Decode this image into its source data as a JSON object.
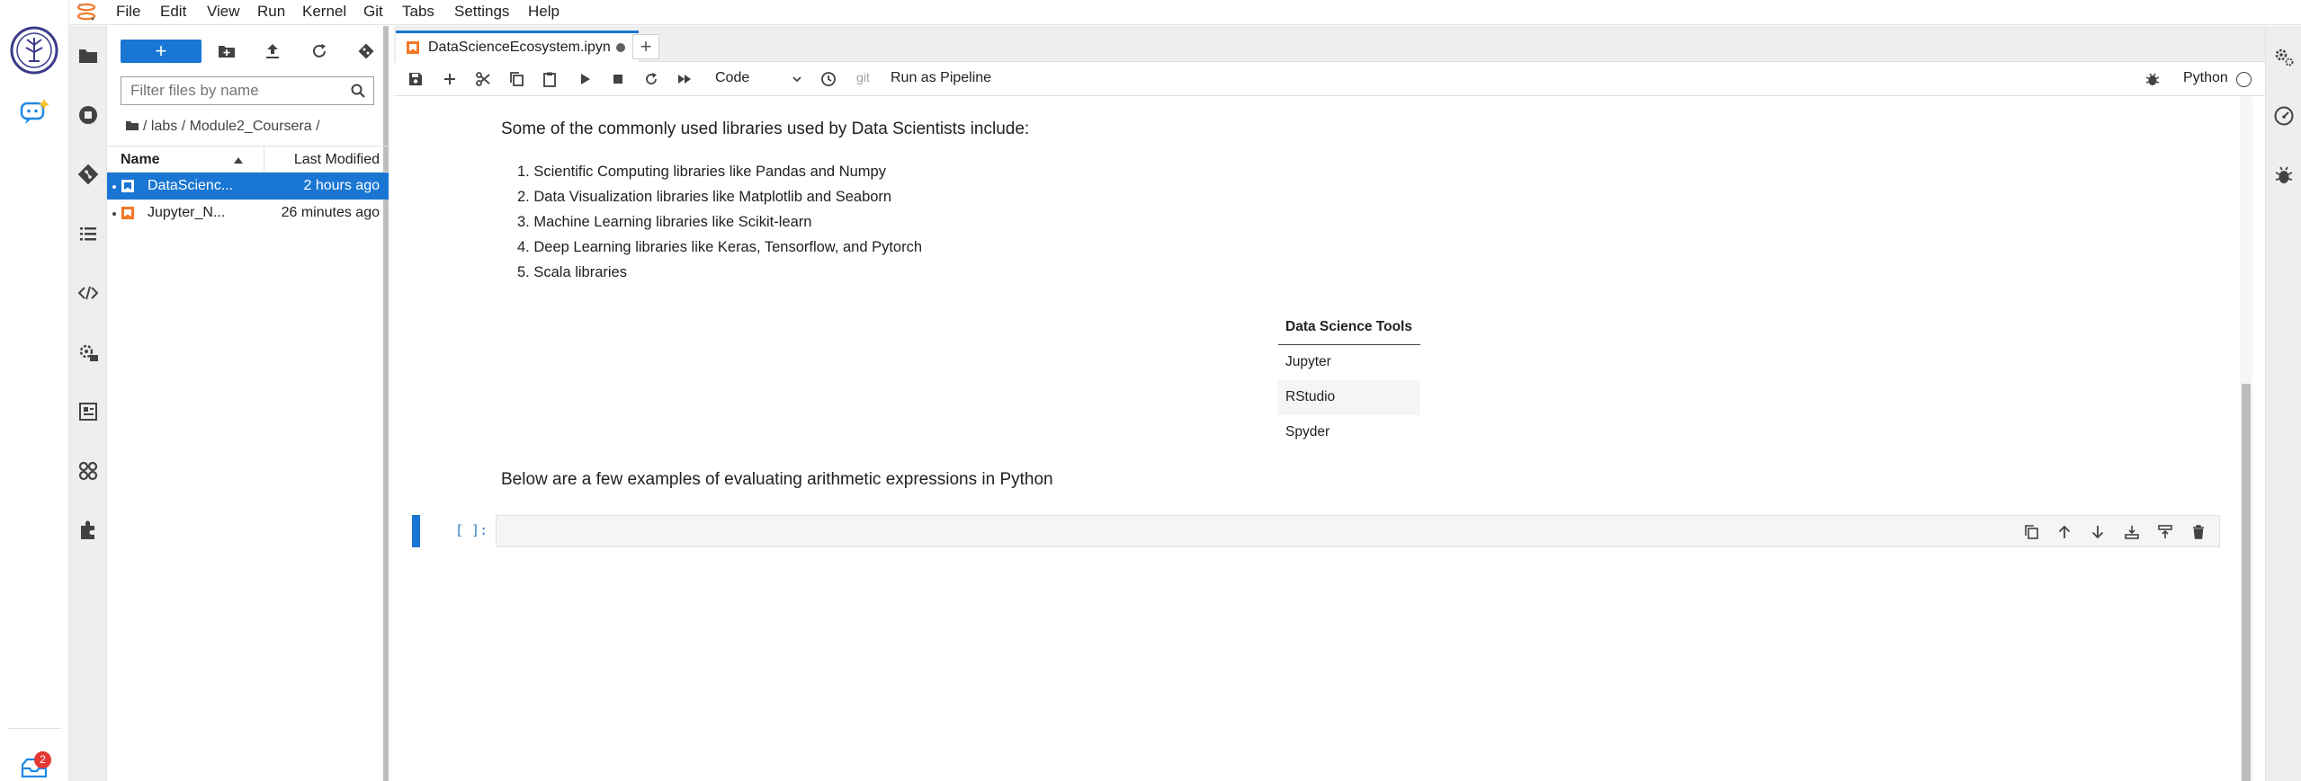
{
  "menu": [
    "File",
    "Edit",
    "View",
    "Run",
    "Kernel",
    "Git",
    "Tabs",
    "Settings",
    "Help"
  ],
  "notification_count": "2",
  "file_browser": {
    "filter_placeholder": "Filter files by name",
    "breadcrumb": "/ labs / Module2_Coursera /",
    "col_name": "Name",
    "col_modified": "Last Modified",
    "files": [
      {
        "name": "DataScienc...",
        "modified": "2 hours ago"
      },
      {
        "name": "Jupyter_N...",
        "modified": "26 minutes ago"
      }
    ]
  },
  "tab": {
    "title": "DataScienceEcosystem.ipyn"
  },
  "toolbar": {
    "cell_type": "Code",
    "git_label": "git",
    "pipeline_label": "Run as Pipeline",
    "kernel_name": "Python"
  },
  "notebook": {
    "intro": "Some of the commonly used libraries used by Data Scientists include:",
    "libraries": [
      "Scientific Computing libraries like Pandas and Numpy",
      "Data Visualization libraries like Matplotlib and Seaborn",
      "Machine Learning libraries like Scikit-learn",
      "Deep Learning libraries like Keras, Tensorflow, and Pytorch",
      "Scala libraries"
    ],
    "table": {
      "header": "Data Science Tools",
      "rows": [
        "Jupyter",
        "RStudio",
        "Spyder"
      ]
    },
    "arith_text": "Below are a few examples of evaluating arithmetic expressions in Python",
    "cell_prompt": "[ ]:"
  },
  "colors": {
    "accent": "#1976d2",
    "orange": "#f37726",
    "badge": "#e53935"
  }
}
